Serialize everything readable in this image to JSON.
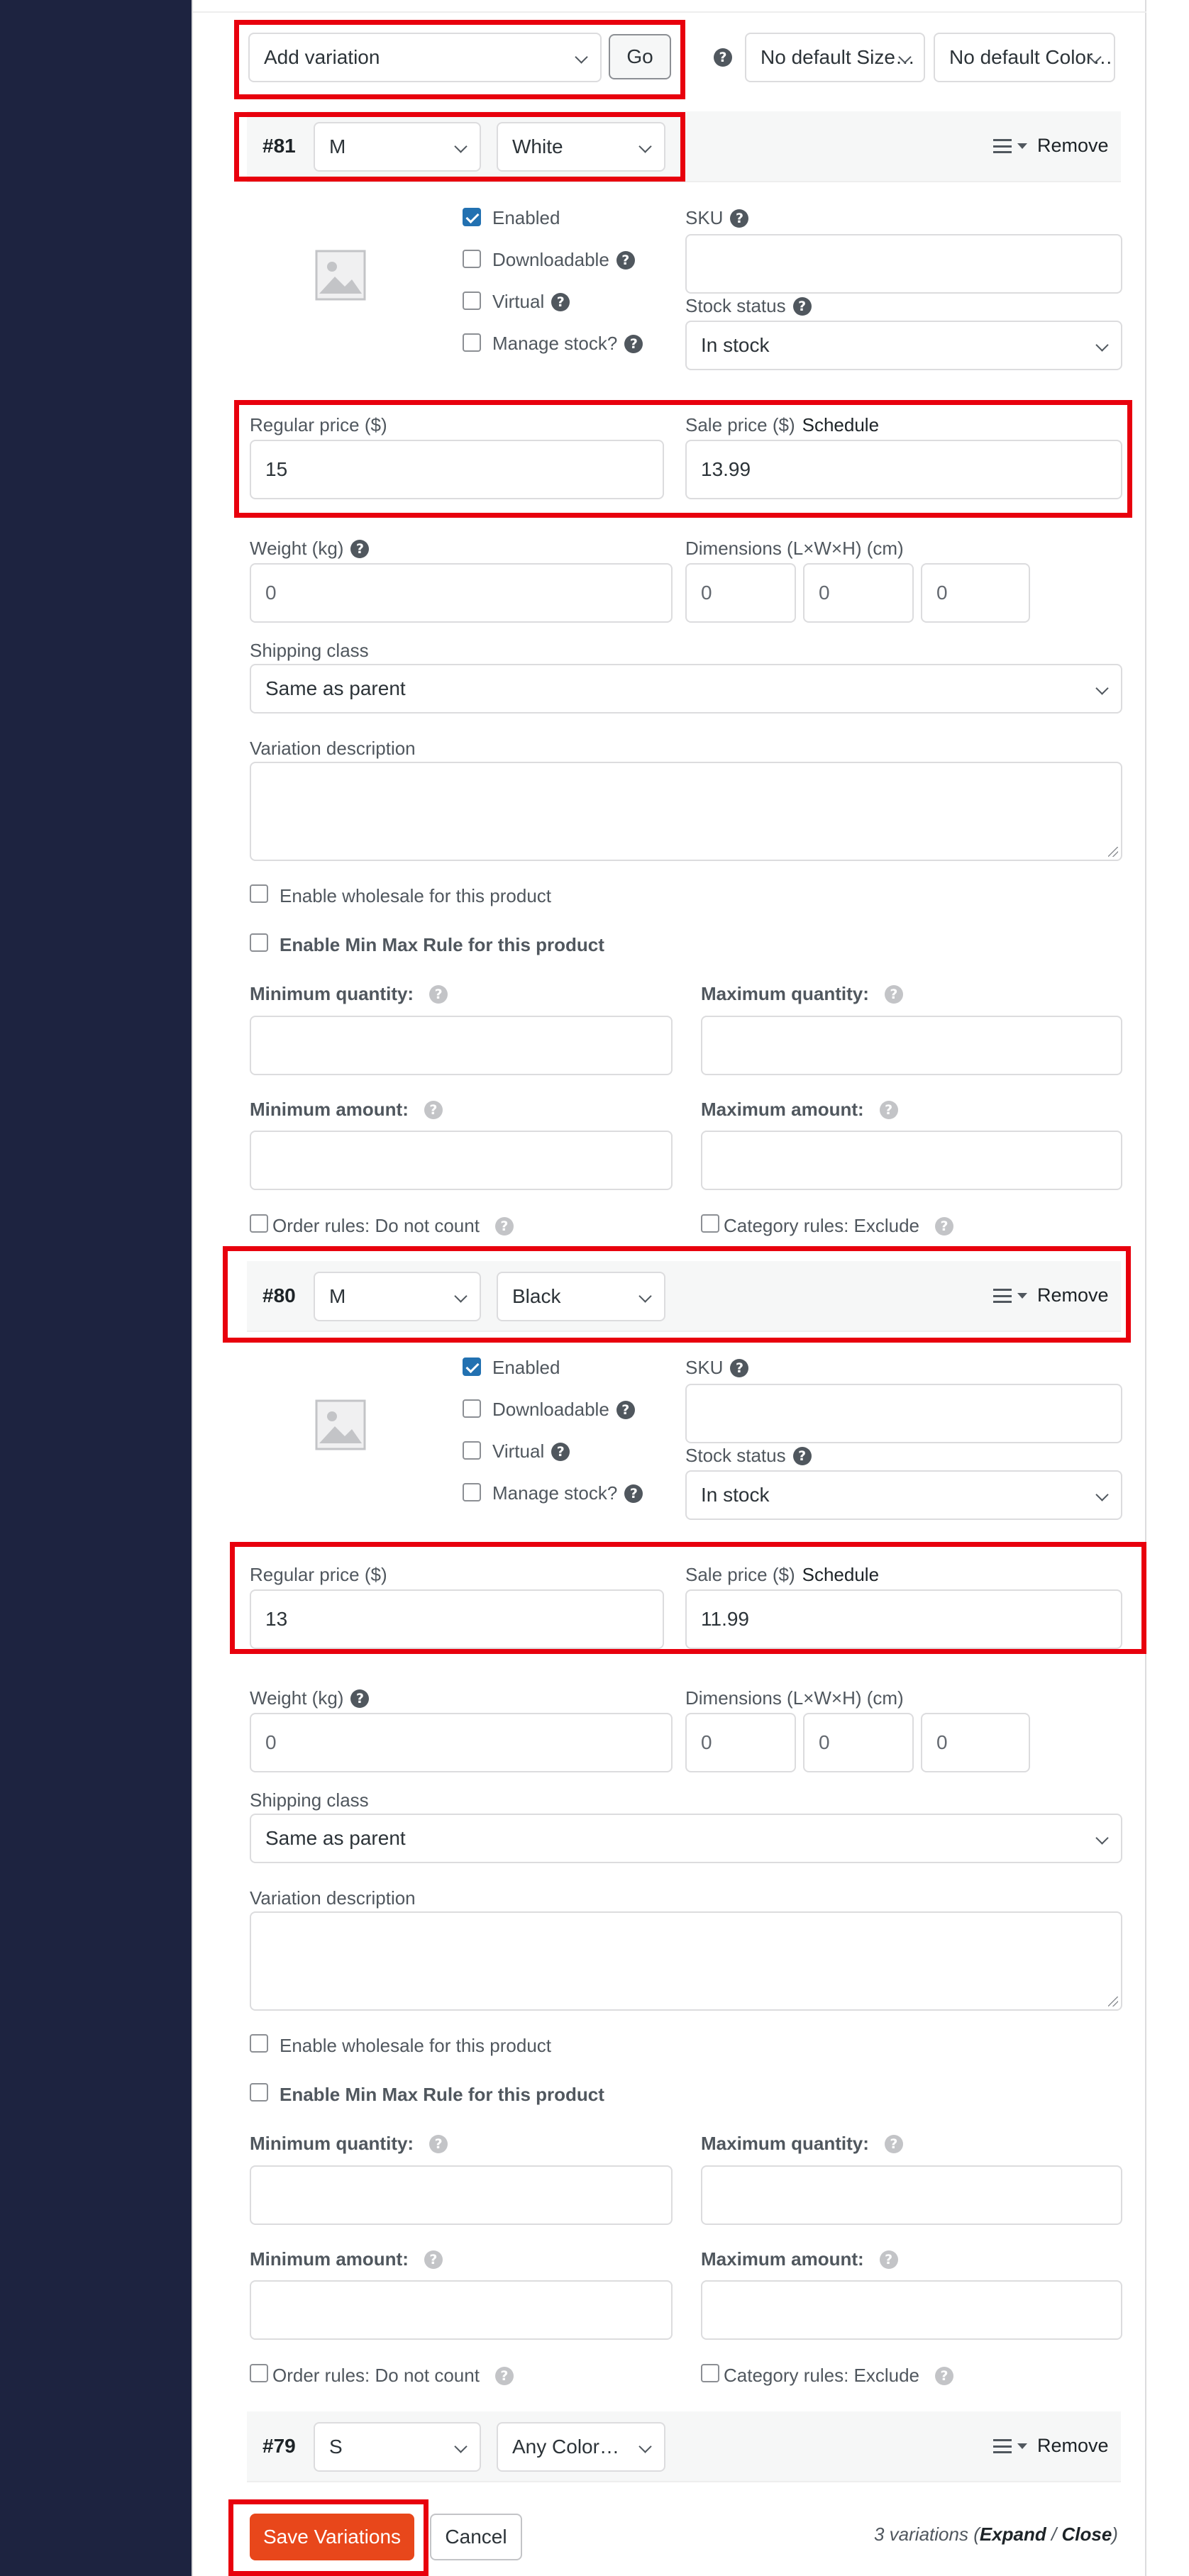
{
  "toolbar": {
    "add_variation": "Add variation",
    "go": "Go",
    "default_size": "No default Size…",
    "default_color": "No default Color…"
  },
  "variations": [
    {
      "id": "#81",
      "size": "M",
      "color": "White",
      "remove": "Remove",
      "enabled": "Enabled",
      "downloadable": "Downloadable",
      "virtual": "Virtual",
      "manage_stock": "Manage stock?",
      "sku_label": "SKU",
      "sku": "",
      "stock_label": "Stock status",
      "stock": "In stock",
      "regular_label": "Regular price ($)",
      "regular": "15",
      "sale_label": "Sale price ($)",
      "schedule": "Schedule",
      "sale": "13.99",
      "weight_label": "Weight (kg)",
      "weight_placeholder": "0",
      "dims_label": "Dimensions (L×W×H) (cm)",
      "length": "0",
      "width": "0",
      "height": "0",
      "shipping_label": "Shipping class",
      "shipping": "Same as parent",
      "desc_label": "Variation description",
      "wholesale": "Enable wholesale for this product",
      "minmax": "Enable Min Max Rule for this product",
      "min_qty": "Minimum quantity:",
      "max_qty": "Maximum quantity:",
      "min_amt": "Minimum amount:",
      "max_amt": "Maximum amount:",
      "order_rules": "Order rules: Do not count",
      "cat_rules": "Category rules: Exclude"
    },
    {
      "id": "#80",
      "size": "M",
      "color": "Black",
      "remove": "Remove",
      "enabled": "Enabled",
      "downloadable": "Downloadable",
      "virtual": "Virtual",
      "manage_stock": "Manage stock?",
      "sku_label": "SKU",
      "sku": "",
      "stock_label": "Stock status",
      "stock": "In stock",
      "regular_label": "Regular price ($)",
      "regular": "13",
      "sale_label": "Sale price ($)",
      "schedule": "Schedule",
      "sale": "11.99",
      "weight_label": "Weight (kg)",
      "weight_placeholder": "0",
      "dims_label": "Dimensions (L×W×H) (cm)",
      "length": "0",
      "width": "0",
      "height": "0",
      "shipping_label": "Shipping class",
      "shipping": "Same as parent",
      "desc_label": "Variation description",
      "wholesale": "Enable wholesale for this product",
      "minmax": "Enable Min Max Rule for this product",
      "min_qty": "Minimum quantity:",
      "max_qty": "Maximum quantity:",
      "min_amt": "Minimum amount:",
      "max_amt": "Maximum amount:",
      "order_rules": "Order rules: Do not count",
      "cat_rules": "Category rules: Exclude"
    },
    {
      "id": "#79",
      "size": "S",
      "color": "Any Color…",
      "remove": "Remove"
    }
  ],
  "footer": {
    "save": "Save Variations",
    "cancel": "Cancel",
    "count": "3 variations",
    "expand": "Expand",
    "slash": "/",
    "close": "Close"
  },
  "colors": {
    "sidebar": "#1d2340",
    "highlight": "#e8000d",
    "primary_button": "#e8471b",
    "checkbox": "#2271b1"
  }
}
